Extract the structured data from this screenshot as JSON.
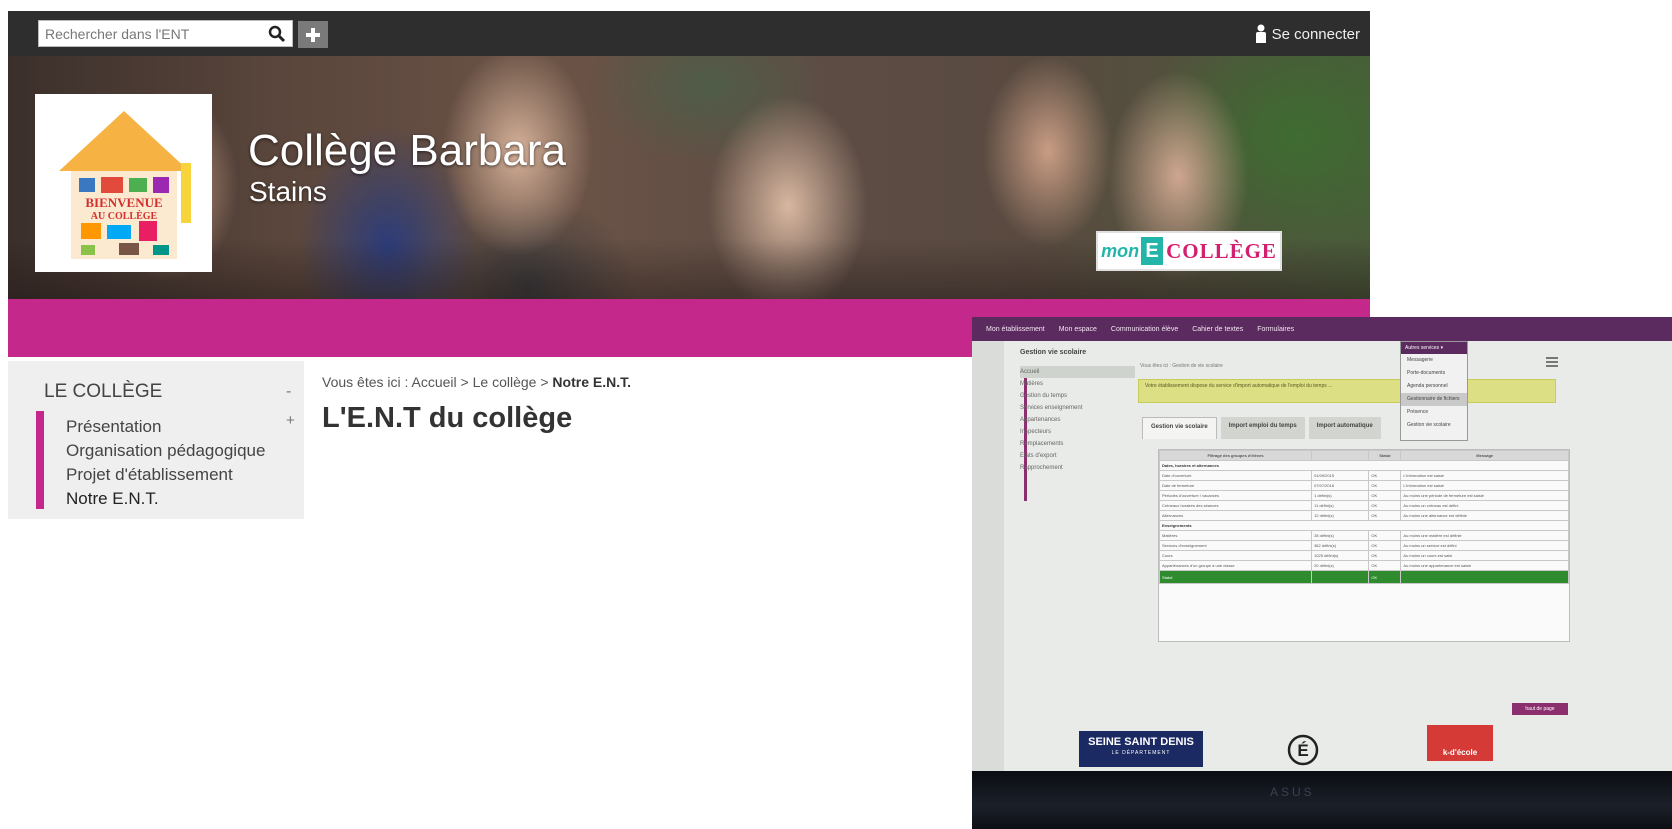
{
  "topbar": {
    "search_placeholder": "Rechercher dans l'ENT",
    "login_label": "Se connecter"
  },
  "banner": {
    "school_name": "Collège Barbara",
    "school_city": "Stains",
    "brand": {
      "mon": "mon",
      "e": "E",
      "college": "COLLÈGE"
    },
    "logo_text": [
      "BIENVENUE",
      "AU COLLÈGE"
    ]
  },
  "sidebar": {
    "section_title": "LE COLLÈGE",
    "collapse_symbol": "-",
    "expand_symbol": "+",
    "items": [
      {
        "label": "Présentation"
      },
      {
        "label": "Organisation pédagogique"
      },
      {
        "label": "Projet d'établissement"
      },
      {
        "label": "Notre E.N.T."
      }
    ]
  },
  "breadcrumb": {
    "prefix": "Vous êtes ici :",
    "items": [
      "Accueil",
      "Le collège",
      "Notre E.N.T."
    ],
    "separator": ">"
  },
  "page": {
    "title": "L'E.N.T du collège"
  },
  "screen_photo": {
    "nav": [
      "Mon établissement",
      "Mon espace",
      "Communication élève",
      "Cahier de textes",
      "Formulaires",
      "Autres services ▾"
    ],
    "side_title": "Gestion vie scolaire",
    "side_items": [
      "Accueil",
      "Matières",
      "Gestion du temps",
      "Services enseignement",
      "Appartenances",
      "Inspecteurs",
      "Remplacements",
      "Etats d'export",
      "Rapprochement"
    ],
    "crumb": "Vous êtes ici : Gestion de vie scolaire",
    "alert": "Votre établissement dispose du service d'import automatique de l'emploi du temps ...",
    "tabs": [
      "Gestion vie scolaire",
      "Import emploi du temps",
      "Import automatique"
    ],
    "table_headers": [
      "Filtrage des groupes d'élèves",
      "Statut",
      "Message"
    ],
    "table_rows": [
      {
        "label": "Dates, horaires et alternances",
        "section": true
      },
      {
        "label": "Date d'ouverture",
        "value": "01/09/2015",
        "status": "OK",
        "msg": "L'information est saisie"
      },
      {
        "label": "Date de fermeture",
        "value": "07/07/2016",
        "status": "OK",
        "msg": "L'information est saisie"
      },
      {
        "label": "Périodes d'ouverture / vacances",
        "value": "1 défini(s)",
        "status": "OK",
        "msg": "Au moins une période de fermeture est saisie"
      },
      {
        "label": "Créneaux horaires des séances",
        "value": "11 défini(s)",
        "status": "OK",
        "msg": "Au moins un créneau est défini"
      },
      {
        "label": "Alternances",
        "value": "12 défini(s)",
        "status": "OK",
        "msg": "Au moins une alternance est définie"
      },
      {
        "label": "Enseignements",
        "section": true
      },
      {
        "label": "Matières",
        "value": "28 défini(s)",
        "status": "OK",
        "msg": "Au moins une matière est définie"
      },
      {
        "label": "Services d'enseignement",
        "value": "362 défini(s)",
        "status": "OK",
        "msg": "Au moins un service est défini"
      },
      {
        "label": "Cours",
        "value": "1025 défini(s)",
        "status": "OK",
        "msg": "Au moins un cours est saisi"
      },
      {
        "label": "Appartenances d'un groupe à une classe",
        "value": "20 défini(s)",
        "status": "OK",
        "msg": "Au moins une appartenance est saisie"
      }
    ],
    "table_total": {
      "label": "Statut",
      "status": "OK"
    },
    "dropdown_title": "Autres services ▾",
    "dropdown_items": [
      "Messagerie",
      "Porte-documents",
      "Agenda personnel",
      "Gestionnaire de fichiers",
      "Présence",
      "Gestion vie scolaire"
    ],
    "top_button": "haut de page",
    "seine_label": "SEINE SAINT DENIS",
    "seine_sub": "LE DÉPARTEMENT",
    "kecole_label": "k-d'école",
    "monitor_brand": "ASUS"
  },
  "colors": {
    "accent_pink": "#c4288a",
    "topbar": "#2e2e2e",
    "screen_nav": "#5b2a5e"
  }
}
